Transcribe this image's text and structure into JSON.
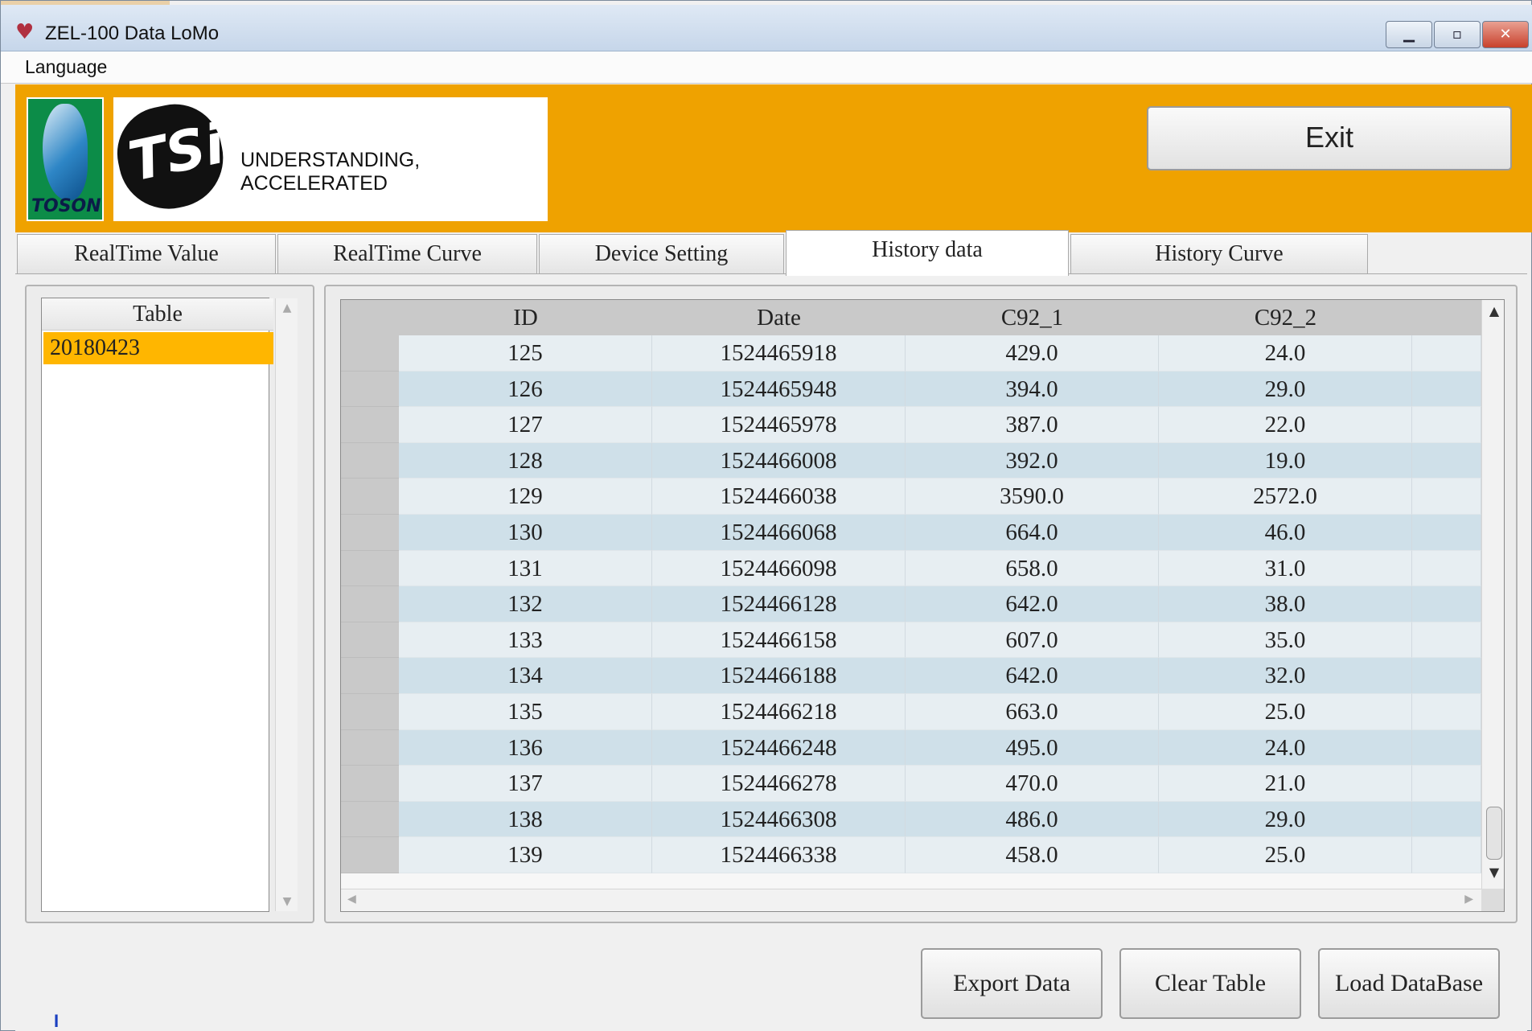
{
  "window": {
    "title": "ZEL-100 Data LoMo"
  },
  "menu": {
    "items": [
      "Language"
    ]
  },
  "banner": {
    "brand_left": "TOSON",
    "brand_tsi": "TSi",
    "tagline": "UNDERSTANDING, ACCELERATED",
    "exit_label": "Exit"
  },
  "tabs": [
    {
      "label": "RealTime Value",
      "active": false
    },
    {
      "label": "RealTime Curve",
      "active": false
    },
    {
      "label": "Device Setting",
      "active": false
    },
    {
      "label": "History data",
      "active": true
    },
    {
      "label": "History Curve",
      "active": false
    }
  ],
  "table_list": {
    "header": "Table",
    "items": [
      "20180423"
    ],
    "selected": "20180423"
  },
  "grid": {
    "columns": [
      "ID",
      "Date",
      "C92_1",
      "C92_2"
    ],
    "rows": [
      [
        "125",
        "1524465918",
        "429.0",
        "24.0"
      ],
      [
        "126",
        "1524465948",
        "394.0",
        "29.0"
      ],
      [
        "127",
        "1524465978",
        "387.0",
        "22.0"
      ],
      [
        "128",
        "1524466008",
        "392.0",
        "19.0"
      ],
      [
        "129",
        "1524466038",
        "3590.0",
        "2572.0"
      ],
      [
        "130",
        "1524466068",
        "664.0",
        "46.0"
      ],
      [
        "131",
        "1524466098",
        "658.0",
        "31.0"
      ],
      [
        "132",
        "1524466128",
        "642.0",
        "38.0"
      ],
      [
        "133",
        "1524466158",
        "607.0",
        "35.0"
      ],
      [
        "134",
        "1524466188",
        "642.0",
        "32.0"
      ],
      [
        "135",
        "1524466218",
        "663.0",
        "25.0"
      ],
      [
        "136",
        "1524466248",
        "495.0",
        "24.0"
      ],
      [
        "137",
        "1524466278",
        "470.0",
        "21.0"
      ],
      [
        "138",
        "1524466308",
        "486.0",
        "29.0"
      ],
      [
        "139",
        "1524466338",
        "458.0",
        "25.0"
      ]
    ]
  },
  "actions": {
    "export_label": "Export Data",
    "clear_label": "Clear Table",
    "load_label": "Load DataBase"
  },
  "status": {
    "cursor_text": "I"
  }
}
